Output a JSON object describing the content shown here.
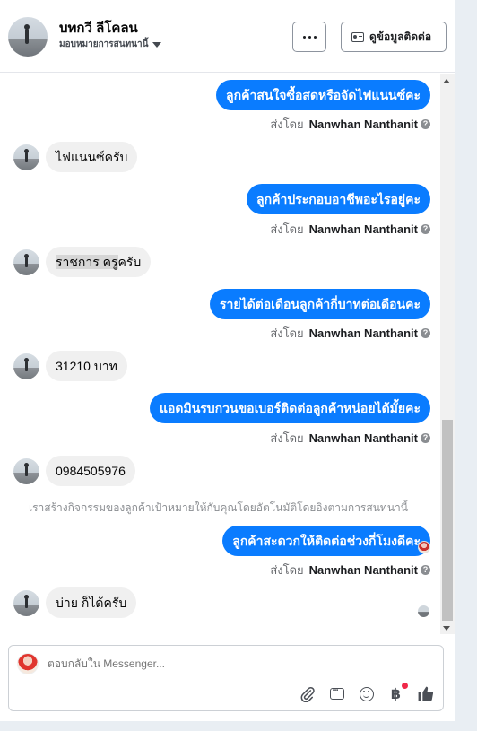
{
  "header": {
    "contact_name": "บทกวี ลีโคลน",
    "assign_label": "มอบหมายการสนทนานี้",
    "more_label": "···",
    "contact_info_label": "ดูข้อมูลติดต่อ"
  },
  "messages": {
    "m1": "ลูกค้าสนใจซื้อสดหรือจัดไฟแนนซ์คะ",
    "m2": "ไฟแนนซ์ครับ",
    "m3": "ลูกค้าประกอบอาชีพอะไรอยู่คะ",
    "m4_part1": "ราชการ ครู",
    "m4_part2": "ครับ",
    "m5": "รายได้ต่อเดือนลูกค้ากี่บาทต่อเดือนคะ",
    "m6": "31210 บาท",
    "m7": "แอดมินรบกวนขอเบอร์ติดต่อลูกค้าหน่อยได้มั้ยคะ",
    "m8": "0984505976",
    "m9": "ลูกค้าสะดวกให้ติดต่อช่วงกี่โมงดีคะ",
    "m10": "บ่าย ก็ได้ครับ"
  },
  "sent_by": {
    "prefix": "ส่งโดย",
    "agent": "Nanwhan Nanthanit",
    "help": "?"
  },
  "system_note": "เราสร้างกิจกรรมของลูกค้าเป้าหมายให้กับคุณโดยอัตโนมัติโดยอิงตามการสนทนานี้",
  "composer": {
    "placeholder": "ตอบกลับใน Messenger...",
    "baht_symbol": "฿",
    "like_symbol": "👍"
  },
  "colors": {
    "outgoing_bubble": "#0a7cff",
    "incoming_bubble": "#f0f0f0",
    "notification_dot": "#f02849"
  },
  "icons": [
    "more-icon",
    "contact-card-icon",
    "caret-down-icon",
    "help-icon",
    "attachment-icon",
    "saved-reply-icon",
    "emoji-icon",
    "baht-icon",
    "like-icon"
  ]
}
